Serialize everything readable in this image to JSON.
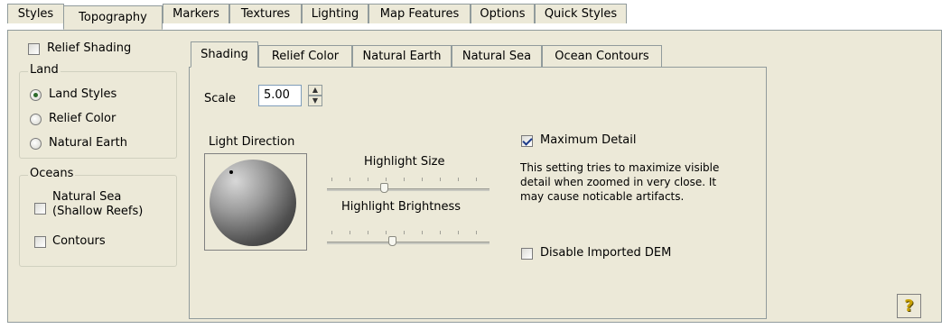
{
  "outer_tabs": [
    "Styles",
    "Topography",
    "Markers",
    "Textures",
    "Lighting",
    "Map Features",
    "Options",
    "Quick Styles"
  ],
  "active_outer_tab": "Topography",
  "left": {
    "relief_shading": {
      "label": "Relief Shading",
      "checked": false
    },
    "land": {
      "title": "Land",
      "options": [
        {
          "label": "Land Styles",
          "checked": true
        },
        {
          "label": "Relief Color",
          "checked": false
        },
        {
          "label": "Natural Earth",
          "checked": false
        }
      ]
    },
    "oceans": {
      "title": "Oceans",
      "natural_sea_line1": "Natural Sea",
      "natural_sea_line2": "(Shallow Reefs)",
      "natural_sea_checked": false,
      "contours_label": "Contours",
      "contours_checked": false
    }
  },
  "inner_tabs": [
    "Shading",
    "Relief Color",
    "Natural Earth",
    "Natural Sea",
    "Ocean Contours"
  ],
  "active_inner_tab": "Shading",
  "shading": {
    "scale_label": "Scale",
    "scale_value": "5.00",
    "light_direction_label": "Light Direction",
    "highlight_size_label": "Highlight Size",
    "highlight_size_level": 0.35,
    "highlight_brightness_label": "Highlight Brightness",
    "highlight_brightness_level": 0.4,
    "maximum_detail": {
      "label": "Maximum Detail",
      "checked": true
    },
    "description_line1": "This setting tries to maximize visible",
    "description_line2": "detail when zoomed in very close.  It",
    "description_line3": "may cause noticable artifacts.",
    "disable_dem": {
      "label": "Disable Imported DEM",
      "checked": false
    }
  },
  "help_icon": "question-mark-icon",
  "help_glyph": "?"
}
